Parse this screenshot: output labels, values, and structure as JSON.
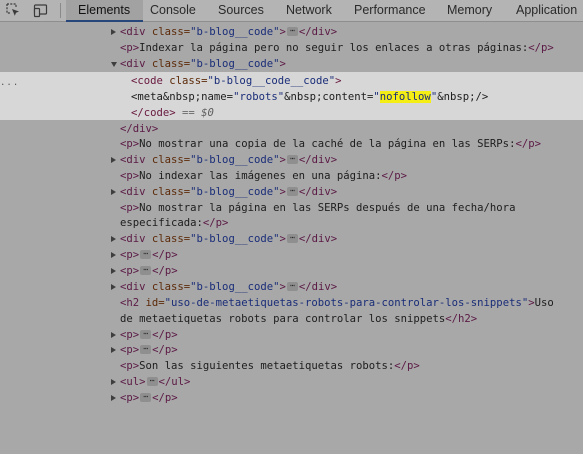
{
  "tabs": [
    {
      "label": "Elements",
      "active": true
    },
    {
      "label": "Console",
      "active": false
    },
    {
      "label": "Sources",
      "active": false
    },
    {
      "label": "Network",
      "active": false
    },
    {
      "label": "Performance",
      "active": false
    },
    {
      "label": "Memory",
      "active": false
    },
    {
      "label": "Application",
      "active": false
    }
  ],
  "toolbar_icons": [
    "inspect-element-icon",
    "device-toolbar-icon"
  ],
  "tree": {
    "r0": {
      "open": "<div",
      "attr": " class=",
      "val": "\"b-blog__code\"",
      "close": ">",
      "end": "</div>"
    },
    "r1": {
      "open": "<p>",
      "text": "Indexar la página pero no seguir los enlaces a otras páginas:",
      "close": "</p>"
    },
    "r2": {
      "open": "<div",
      "attr": " class=",
      "val": "\"b-blog__code\"",
      "close": ">"
    },
    "r3": {
      "open": "<code",
      "attr": " class=",
      "val": "\"b-blog__code__code\"",
      "close": ">"
    },
    "r4": {
      "pre": "<meta&nbsp;name=",
      "v1": "\"robots\"",
      "mid": "&nbsp;content=",
      "q1": "\"",
      "hl": "nofollow",
      "q2": "\"",
      "post": "&nbsp;/>"
    },
    "r5": {
      "close": "</code>",
      "eq": " == ",
      "dollar": "$0"
    },
    "r6": {
      "close": "</div>"
    },
    "r7": {
      "open": "<p>",
      "text": "No mostrar una copia de la caché de la página en las SERPs:",
      "close": "</p>"
    },
    "r8": {
      "open": "<div",
      "attr": " class=",
      "val": "\"b-blog__code\"",
      "close": ">",
      "end": "</div>"
    },
    "r9": {
      "open": "<p>",
      "text": "No indexar las imágenes en una página:",
      "close": "</p>"
    },
    "r10": {
      "open": "<div",
      "attr": " class=",
      "val": "\"b-blog__code\"",
      "close": ">",
      "end": "</div>"
    },
    "r11": {
      "open": "<p>",
      "text": "No mostrar la página en las SERPs después de una fecha/hora"
    },
    "r12": {
      "text": "especificada:",
      "close": "</p>"
    },
    "r13": {
      "open": "<div",
      "attr": " class=",
      "val": "\"b-blog__code\"",
      "close": ">",
      "end": "</div>"
    },
    "r14": {
      "open": "<p>",
      "end": "</p>"
    },
    "r15": {
      "open": "<p>",
      "end": "</p>"
    },
    "r16": {
      "open": "<div",
      "attr": " class=",
      "val": "\"b-blog__code\"",
      "close": ">",
      "end": "</div>"
    },
    "r17": {
      "open": "<h2",
      "attr": " id=",
      "val": "\"uso-de-metaetiquetas-robots-para-controlar-los-snippets\"",
      "close": ">",
      "text": "Uso"
    },
    "r18": {
      "text": "de metaetiquetas robots para controlar los snippets",
      "close": "</h2>"
    },
    "r19": {
      "open": "<p>",
      "end": "</p>"
    },
    "r20": {
      "open": "<p>",
      "end": "</p>"
    },
    "r21": {
      "open": "<p>",
      "text": "Son las siguientes metaetiquetas robots:",
      "close": "</p>"
    },
    "r22": {
      "open": "<ul>",
      "end": "</ul>"
    },
    "r23": {
      "open": "<p>",
      "end": "</p>"
    }
  },
  "ellipsis": "⋯",
  "left_gutter_dots": "...",
  "colors": {
    "background": "#a8a8a8",
    "selected_row": "#d7d7d7",
    "highlight": "#f5ee15",
    "tag": "#5b1a45",
    "attr_value": "#1a2d78"
  }
}
